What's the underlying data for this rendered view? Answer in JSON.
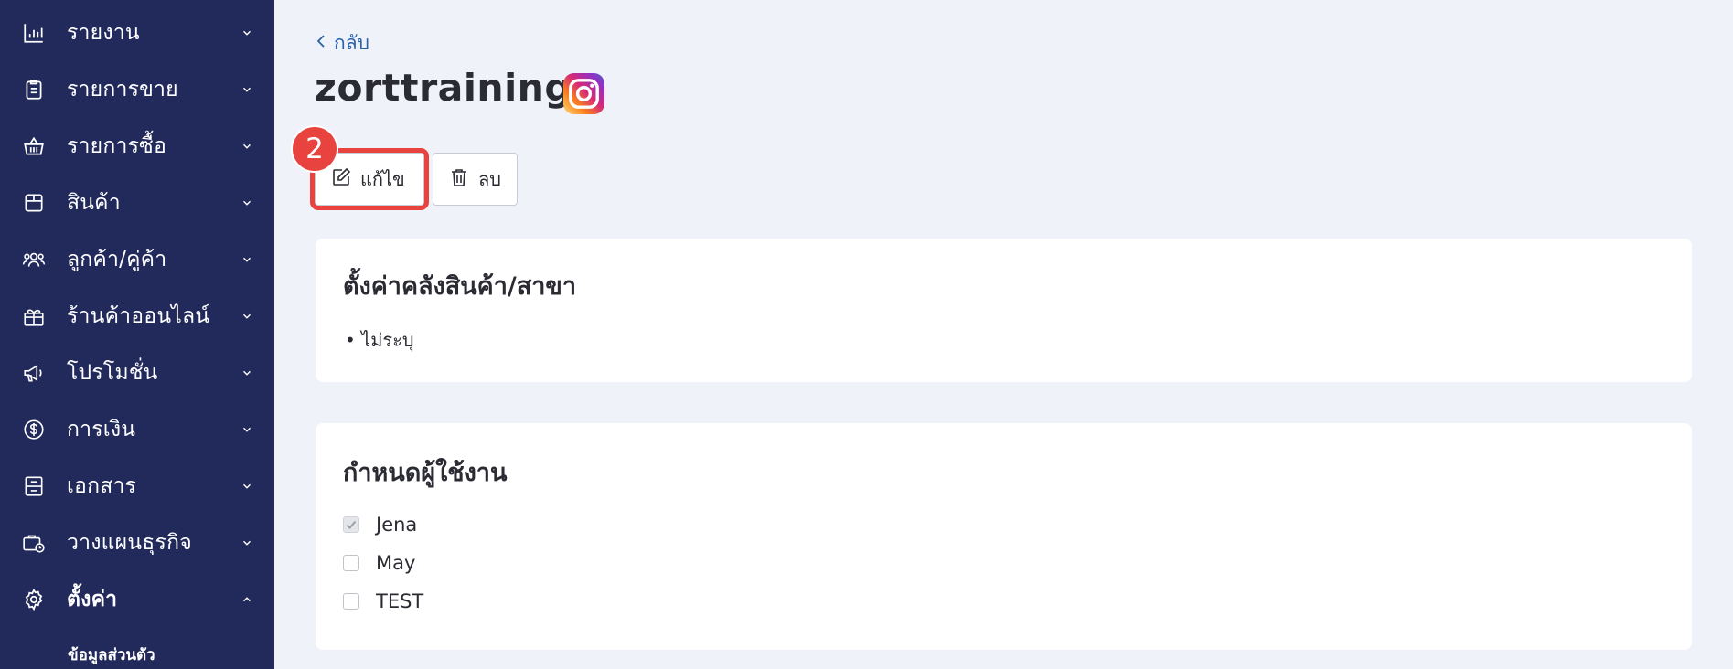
{
  "sidebar": {
    "items": [
      {
        "label": "รายงาน",
        "icon": "bar-chart-icon"
      },
      {
        "label": "รายการขาย",
        "icon": "clipboard-list-icon"
      },
      {
        "label": "รายการซื้อ",
        "icon": "basket-icon"
      },
      {
        "label": "สินค้า",
        "icon": "box-icon"
      },
      {
        "label": "ลูกค้า/คู่ค้า",
        "icon": "users-icon"
      },
      {
        "label": "ร้านค้าออนไลน์",
        "icon": "gift-store-icon"
      },
      {
        "label": "โปรโมชั่น",
        "icon": "megaphone-icon"
      },
      {
        "label": "การเงิน",
        "icon": "dollar-circle-icon"
      },
      {
        "label": "เอกสาร",
        "icon": "archive-icon"
      },
      {
        "label": "วางแผนธุรกิจ",
        "icon": "briefcase-clock-icon"
      },
      {
        "label": "ตั้งค่า",
        "icon": "gear-icon",
        "expanded": true
      }
    ],
    "sub_item": "ข้อมูลส่วนตัว"
  },
  "header": {
    "back_label": "กลับ",
    "title": "zorttraining",
    "channel_icon": "instagram-icon"
  },
  "actions": {
    "step_number": "2",
    "edit_label": "แก้ไข",
    "delete_label": "ลบ",
    "highlight_color": "#e8433e"
  },
  "warehouse_card": {
    "title": "ตั้งค่าคลังสินค้า/สาขา",
    "value": "• ไม่ระบุ"
  },
  "users_card": {
    "title": "กำหนดผู้ใช้งาน",
    "users": [
      {
        "name": "Jena",
        "checked": true
      },
      {
        "name": "May",
        "checked": false
      },
      {
        "name": "TEST",
        "checked": false
      }
    ]
  },
  "colors": {
    "sidebar_bg": "#222a5c",
    "page_bg": "#eff2f8",
    "link": "#2a62a8"
  }
}
